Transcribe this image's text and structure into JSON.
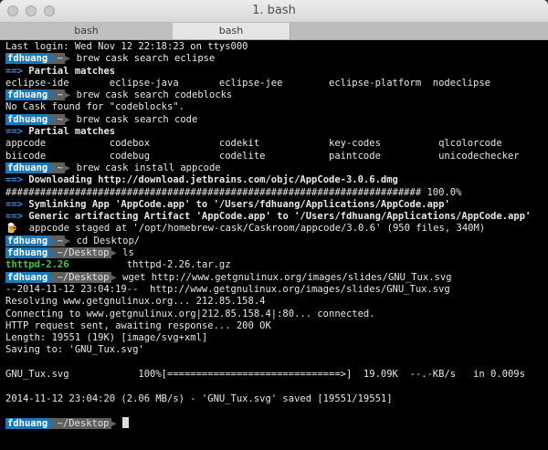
{
  "window": {
    "title": "1. bash",
    "tabs": [
      {
        "label": "bash",
        "active": false
      },
      {
        "label": "bash",
        "active": true
      }
    ]
  },
  "colors": {
    "prompt_user_bg": "#1a78b8",
    "prompt_path_bg": "#5f5f5f",
    "arrow_blue": "#3b8eea",
    "dir_green": "#48c04a"
  },
  "terminal": {
    "lines": [
      {
        "segs": [
          {
            "t": "Last login: Wed Nov 12 22:18:23 on ttys000"
          }
        ]
      },
      {
        "prompt": {
          "user": "fdhuang",
          "path": "~"
        },
        "segs": [
          {
            "t": " brew cask search eclipse"
          }
        ]
      },
      {
        "segs": [
          {
            "t": "==>",
            "c": "blue"
          },
          {
            "t": " Partial matches",
            "c": "bold"
          }
        ]
      },
      {
        "segs": [
          {
            "t": "eclipse-ide       eclipse-java       eclipse-jee        eclipse-platform  nodeclipse"
          }
        ]
      },
      {
        "prompt": {
          "user": "fdhuang",
          "path": "~"
        },
        "segs": [
          {
            "t": " brew cask search codeblocks"
          }
        ]
      },
      {
        "segs": [
          {
            "t": "No Cask found for \"codeblocks\"."
          }
        ]
      },
      {
        "prompt": {
          "user": "fdhuang",
          "path": "~"
        },
        "segs": [
          {
            "t": " brew cask search code"
          }
        ]
      },
      {
        "segs": [
          {
            "t": "==>",
            "c": "blue"
          },
          {
            "t": " Partial matches",
            "c": "bold"
          }
        ]
      },
      {
        "segs": [
          {
            "t": "appcode           codebox            codekit            key-codes          qlcolorcode"
          }
        ]
      },
      {
        "segs": [
          {
            "t": "biicode           codebug            codelite           paintcode          unicodechecker"
          }
        ]
      },
      {
        "prompt": {
          "user": "fdhuang",
          "path": "~"
        },
        "segs": [
          {
            "t": " brew cask install appcode"
          }
        ]
      },
      {
        "segs": [
          {
            "t": "==>",
            "c": "blue"
          },
          {
            "t": " Downloading http://download.jetbrains.com/objc/AppCode-3.0.6.dmg",
            "c": "bold"
          }
        ]
      },
      {
        "segs": [
          {
            "t": "######################################################################## 100.0%"
          }
        ]
      },
      {
        "segs": [
          {
            "t": "==>",
            "c": "blue"
          },
          {
            "t": " Symlinking App 'AppCode.app' to '/Users/fdhuang/Applications/AppCode.app'",
            "c": "bold"
          }
        ]
      },
      {
        "segs": [
          {
            "t": "==>",
            "c": "blue"
          },
          {
            "t": " Generic artifacting Artifact 'AppCode.app' to '/Users/fdhuang/Applications/AppCode.app'",
            "c": "bold"
          }
        ]
      },
      {
        "segs": [
          {
            "t": "🍺 "
          },
          {
            "t": " appcode staged at '/opt/homebrew-cask/Caskroom/appcode/3.0.6' (950 files, 340M)"
          }
        ]
      },
      {
        "prompt": {
          "user": "fdhuang",
          "path": "~"
        },
        "segs": [
          {
            "t": " cd Desktop/"
          }
        ]
      },
      {
        "prompt": {
          "user": "fdhuang",
          "path": "~/Desktop"
        },
        "segs": [
          {
            "t": " ls"
          }
        ]
      },
      {
        "segs": [
          {
            "t": "thttpd-2.26",
            "c": "green"
          },
          {
            "t": "          thttpd-2.26.tar.gz"
          }
        ]
      },
      {
        "prompt": {
          "user": "fdhuang",
          "path": "~/Desktop"
        },
        "segs": [
          {
            "t": " wget http://www.getgnulinux.org/images/slides/GNU_Tux.svg"
          }
        ]
      },
      {
        "segs": [
          {
            "t": "--2014-11-12 23:04:19--  http://www.getgnulinux.org/images/slides/GNU_Tux.svg"
          }
        ]
      },
      {
        "segs": [
          {
            "t": "Resolving www.getgnulinux.org... 212.85.158.4"
          }
        ]
      },
      {
        "segs": [
          {
            "t": "Connecting to www.getgnulinux.org|212.85.158.4|:80... connected."
          }
        ]
      },
      {
        "segs": [
          {
            "t": "HTTP request sent, awaiting response... 200 OK"
          }
        ]
      },
      {
        "segs": [
          {
            "t": "Length: 19551 (19K) [image/svg+xml]"
          }
        ]
      },
      {
        "segs": [
          {
            "t": "Saving to: 'GNU_Tux.svg'"
          }
        ]
      },
      {
        "segs": [
          {
            "t": ""
          }
        ]
      },
      {
        "segs": [
          {
            "t": "GNU_Tux.svg            100%[==============================>]  19.09K  --.-KB/s   in 0.009s"
          }
        ]
      },
      {
        "segs": [
          {
            "t": ""
          }
        ]
      },
      {
        "segs": [
          {
            "t": "2014-11-12 23:04:20 (2.06 MB/s) - 'GNU_Tux.svg' saved [19551/19551]"
          }
        ]
      },
      {
        "segs": [
          {
            "t": ""
          }
        ]
      },
      {
        "prompt": {
          "user": "fdhuang",
          "path": "~/Desktop"
        },
        "cursor": true,
        "segs": [
          {
            "t": " "
          }
        ]
      }
    ]
  }
}
